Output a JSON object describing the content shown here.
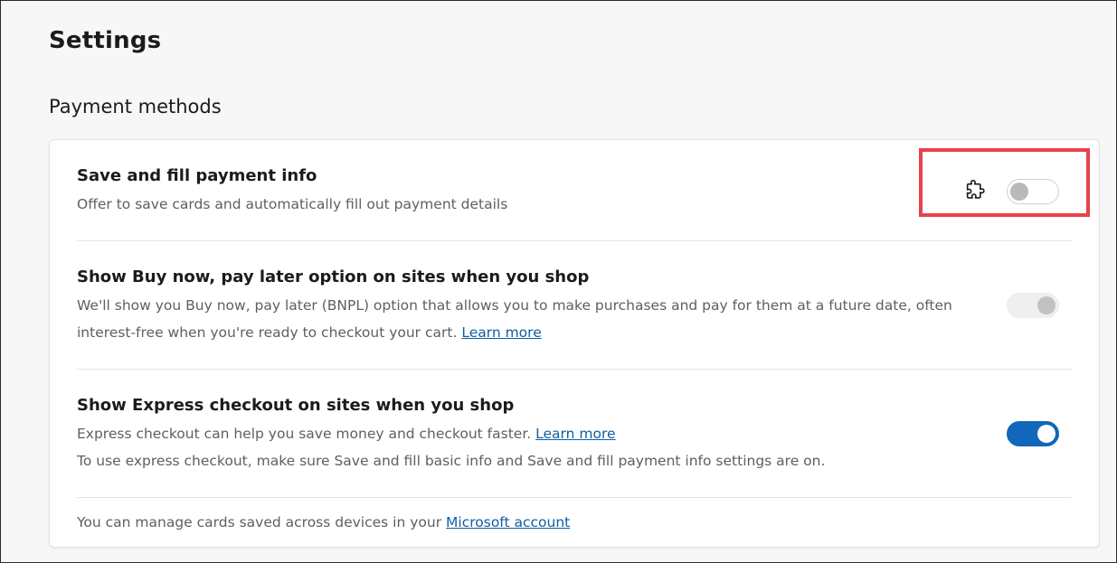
{
  "page": {
    "title": "Settings"
  },
  "section": {
    "title": "Payment methods"
  },
  "settings": [
    {
      "title": "Save and fill payment info",
      "desc_line1": "Offer to save cards and automatically fill out payment details",
      "toggle_state": "off",
      "managed_by_extension_icon": "puzzle-piece-icon"
    },
    {
      "title": "Show Buy now, pay later option on sites when you shop",
      "desc_line1": "We'll show you Buy now, pay later (BNPL) option that allows you to make purchases and pay for them at a future date, often",
      "desc_line2": "interest-free when you're ready to checkout your cart.",
      "link": "Learn more",
      "toggle_state": "disabled-on"
    },
    {
      "title": "Show Express checkout on sites when you shop",
      "desc_line1": "Express checkout can help you save money and checkout faster.",
      "link": "Learn more",
      "desc_line2": "To use express checkout, make sure Save and fill basic info and Save and fill payment info settings are on.",
      "toggle_state": "on"
    }
  ],
  "footer": {
    "text": "You can manage cards saved across devices in your",
    "link": "Microsoft account"
  },
  "colors": {
    "accent": "#1167b9",
    "link": "#115ea3",
    "highlight": "#e8424b"
  }
}
